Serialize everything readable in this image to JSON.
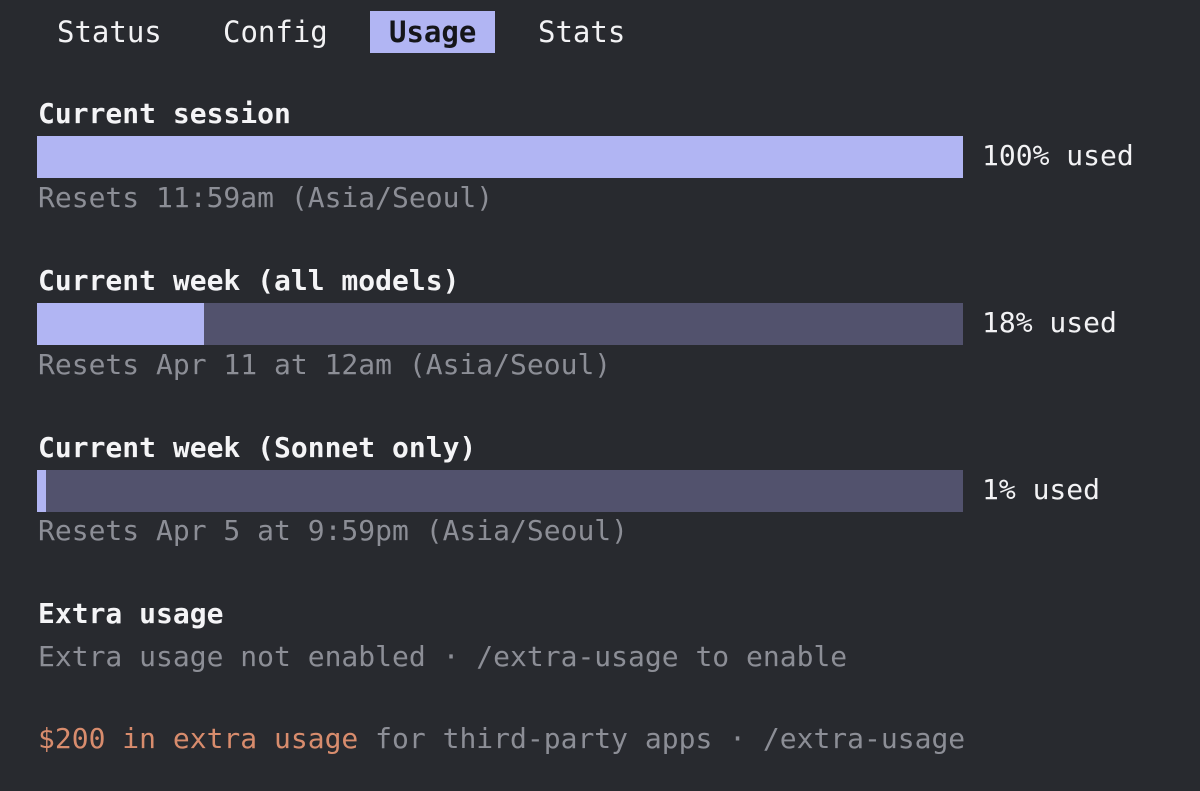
{
  "tabs": [
    {
      "label": "Status",
      "active": false
    },
    {
      "label": "Config",
      "active": false
    },
    {
      "label": "Usage",
      "active": true
    },
    {
      "label": "Stats",
      "active": false
    }
  ],
  "sections": [
    {
      "title": "Current session",
      "percent": 100,
      "used_label": "100% used",
      "reset_text": "Resets 11:59am (Asia/Seoul)"
    },
    {
      "title": "Current week (all models)",
      "percent": 18,
      "used_label": "18% used",
      "reset_text": "Resets Apr 11 at 12am (Asia/Seoul)"
    },
    {
      "title": "Current week (Sonnet only)",
      "percent": 1,
      "used_label": "1% used",
      "reset_text": "Resets Apr 5 at 9:59pm (Asia/Seoul)"
    }
  ],
  "extra": {
    "title": "Extra usage",
    "status_text": "Extra usage not enabled · /extra-usage to enable"
  },
  "promo": {
    "highlight": "$200 in extra usage",
    "rest": " for third-party apps · /extra-usage"
  },
  "colors": {
    "background": "#282a2f",
    "bar_fill": "#b1b5f3",
    "bar_track": "#52526d",
    "muted_text": "#8c8e96",
    "accent": "#d88c6d"
  }
}
